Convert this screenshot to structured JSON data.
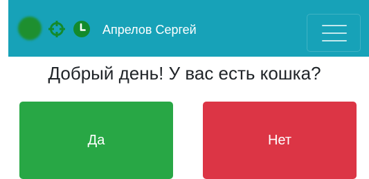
{
  "navbar": {
    "background_color": "#17a2b8",
    "status_indicator_color": "#1e8f2f",
    "icons": [
      "crosshair-icon",
      "clock-icon",
      "hamburger-menu-icon"
    ],
    "user_name": "Апрелов Сергей"
  },
  "main": {
    "question": "Добрый день! У вас есть кошка?",
    "buttons": {
      "yes_label": "Да",
      "yes_color": "#28a745",
      "no_label": "Нет",
      "no_color": "#dc3545"
    }
  }
}
